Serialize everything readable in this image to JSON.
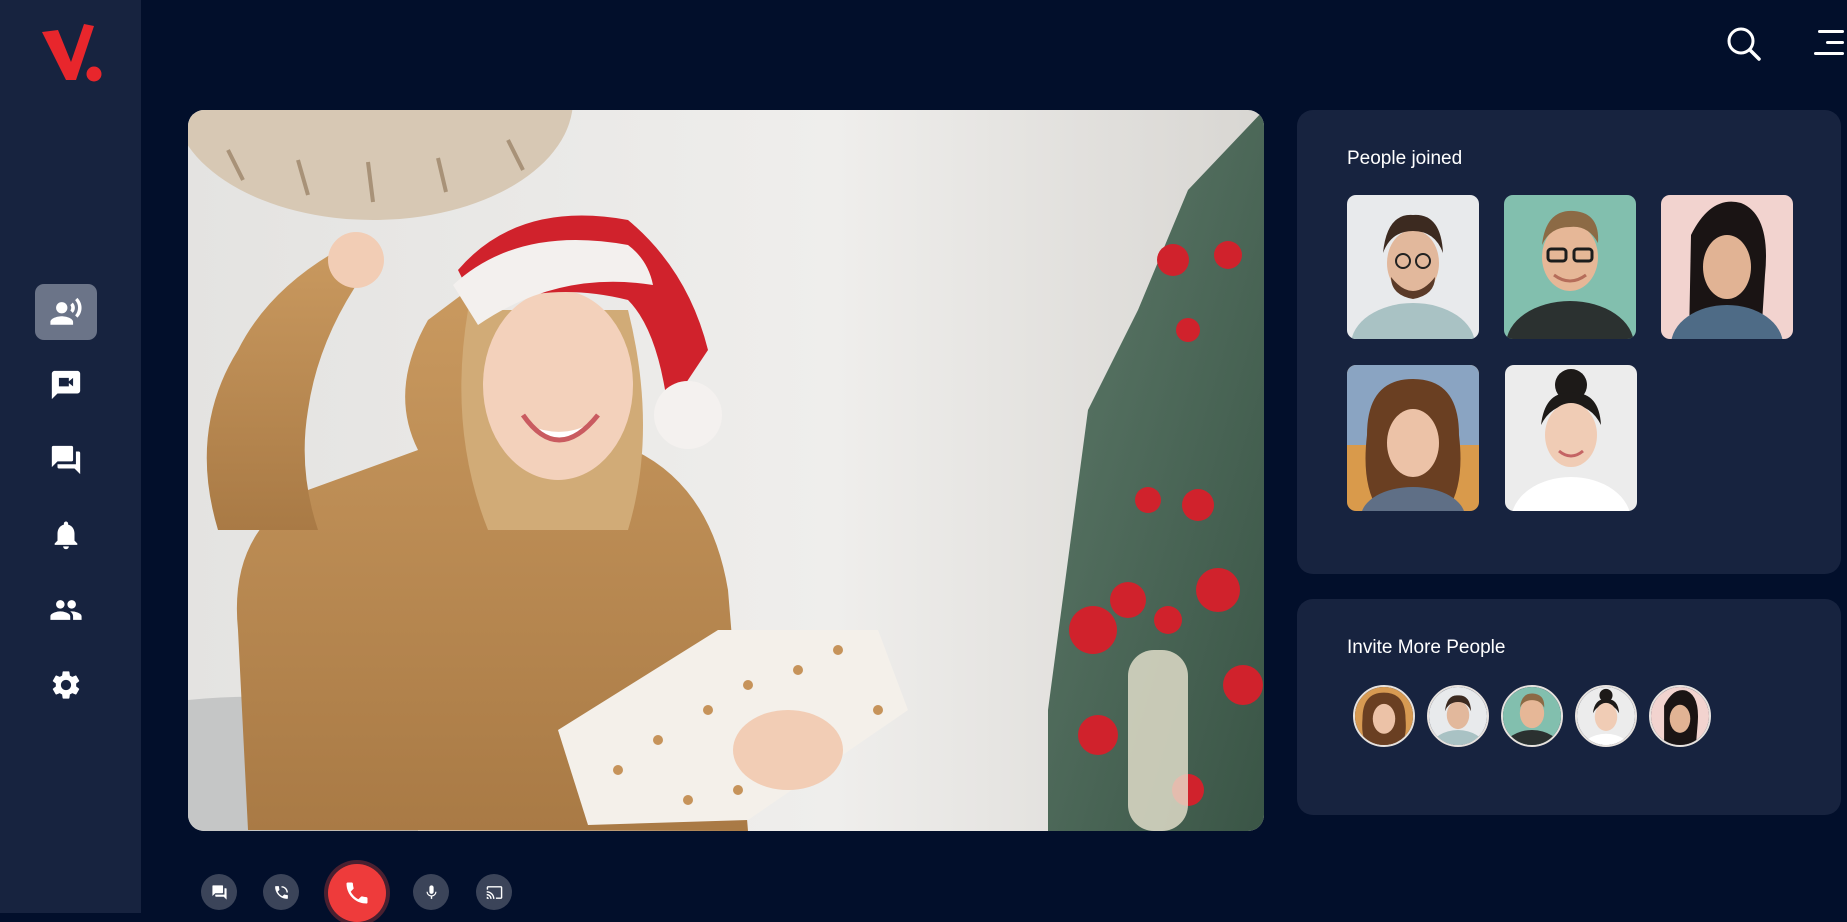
{
  "app": {
    "brand_color": "#e8262c",
    "logo_icon": "v-dot-logo"
  },
  "sidebar": {
    "items": [
      {
        "name": "voice-call",
        "icon": "speaking-person-icon",
        "active": true
      },
      {
        "name": "video-chat",
        "icon": "video-message-icon",
        "active": false
      },
      {
        "name": "messages",
        "icon": "forum-icon",
        "active": false
      },
      {
        "name": "notifications",
        "icon": "bell-icon",
        "active": false
      },
      {
        "name": "contacts",
        "icon": "people-icon",
        "active": false
      },
      {
        "name": "settings",
        "icon": "gear-icon",
        "active": false
      }
    ]
  },
  "topbar": {
    "icons": [
      "search-icon",
      "menu-icon"
    ]
  },
  "people_joined": {
    "title": "People joined",
    "participants": [
      "man-curly-glasses",
      "man-glasses-smile",
      "woman-dark-hair",
      "woman-curly-hair",
      "woman-bun-hair"
    ]
  },
  "invite": {
    "title": "Invite More People",
    "contacts": [
      "woman-curly-hair",
      "man-curly-glasses",
      "man-glasses-smile",
      "woman-bun-hair",
      "woman-dark-hair"
    ]
  },
  "controls": {
    "buttons": [
      "chat-icon",
      "call-forward-icon",
      "end-call-icon",
      "microphone-icon",
      "cast-icon"
    ],
    "end_call_color": "#ee3b3b"
  }
}
